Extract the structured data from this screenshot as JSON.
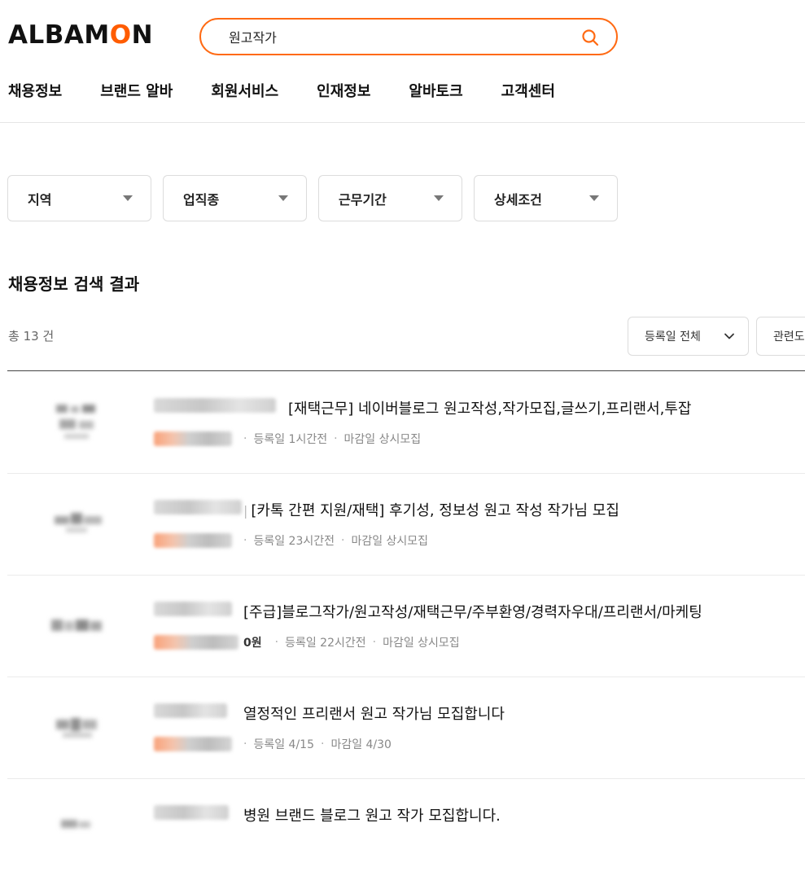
{
  "header": {
    "logo_prefix": "ALBAM",
    "logo_o": "O",
    "logo_suffix": "N",
    "search_value": "원고작가",
    "nav": [
      "채용정보",
      "브랜드 알바",
      "회원서비스",
      "인재정보",
      "알바토크",
      "고객센터"
    ]
  },
  "filters": [
    "지역",
    "업직종",
    "근무기간",
    "상세조건"
  ],
  "results": {
    "title": "채용정보 검색 결과",
    "count_text": "총 13 건",
    "sort_label": "등록일 전체",
    "sort2_label": "관련도"
  },
  "jobs": [
    {
      "title": "[재택근무] 네이버블로그 원고작성,작가모집,글쓰기,프리랜서,투잡",
      "pay_suffix": "",
      "registered": "등록일 1시간전",
      "deadline": "마감일 상시모집"
    },
    {
      "title": "[카톡 간편 지원/재택] 후기성, 정보성 원고 작성 작가님 모집",
      "pay_suffix": "",
      "registered": "등록일 23시간전",
      "deadline": "마감일 상시모집"
    },
    {
      "title": "[주급]블로그작가/원고작성/재택근무/주부환영/경력자우대/프리랜서/마케팅",
      "pay_suffix": "0원",
      "registered": "등록일 22시간전",
      "deadline": "마감일 상시모집"
    },
    {
      "title": "열정적인 프리랜서 원고 작가님 모집합니다",
      "pay_suffix": "",
      "registered": "등록일 4/15",
      "deadline": "마감일 4/30"
    },
    {
      "title": "병원 브랜드 블로그 원고 작가 모집합니다.",
      "pay_suffix": "",
      "registered": "",
      "deadline": ""
    }
  ]
}
